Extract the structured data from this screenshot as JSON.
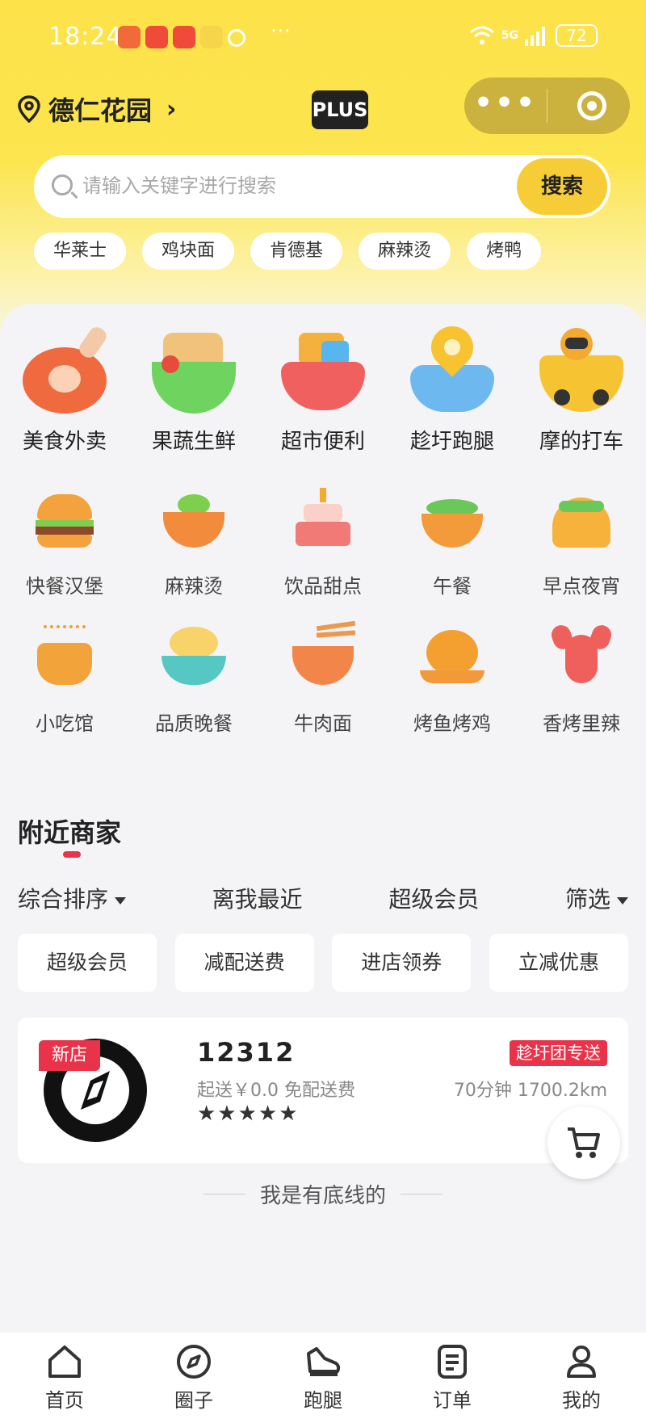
{
  "status_bar": {
    "time": "18:24",
    "signal": "5G",
    "battery": "72"
  },
  "location": {
    "name": "德仁花园"
  },
  "plus_label": "PLUS",
  "search": {
    "placeholder": "请输入关键字进行搜索",
    "button_label": "搜索"
  },
  "hot_tags": [
    "华莱士",
    "鸡块面",
    "肯德基",
    "麻辣烫",
    "烤鸭"
  ],
  "main_categories": [
    {
      "label": "美食外卖",
      "icon": "roast-leg-icon"
    },
    {
      "label": "果蔬生鲜",
      "icon": "vegetable-basket-icon"
    },
    {
      "label": "超市便利",
      "icon": "shopping-cart-icon"
    },
    {
      "label": "趁圩跑腿",
      "icon": "map-pin-icon"
    },
    {
      "label": "摩的打车",
      "icon": "motorbike-rider-icon"
    }
  ],
  "sub_categories_row1": [
    {
      "label": "快餐汉堡",
      "icon": "burger-icon"
    },
    {
      "label": "麻辣烫",
      "icon": "spicy-bowl-icon"
    },
    {
      "label": "饮品甜点",
      "icon": "cake-icon"
    },
    {
      "label": "午餐",
      "icon": "lunch-bowl-icon"
    },
    {
      "label": "早点夜宵",
      "icon": "taco-icon"
    }
  ],
  "sub_categories_row2": [
    {
      "label": "小吃馆",
      "icon": "pot-icon"
    },
    {
      "label": "品质晚餐",
      "icon": "dinner-bowl-icon"
    },
    {
      "label": "牛肉面",
      "icon": "noodle-bowl-icon"
    },
    {
      "label": "烤鱼烤鸡",
      "icon": "roast-chicken-icon"
    },
    {
      "label": "香烤里辣",
      "icon": "crayfish-icon"
    }
  ],
  "nearby": {
    "title": "附近商家",
    "sort_options": [
      {
        "label": "综合排序",
        "dropdown": true
      },
      {
        "label": "离我最近",
        "dropdown": false
      },
      {
        "label": "超级会员",
        "dropdown": false
      },
      {
        "label": "筛选",
        "dropdown": true
      }
    ],
    "filter_chips": [
      "超级会员",
      "减配送费",
      "进店领券",
      "立减优惠"
    ],
    "stores": [
      {
        "badge": "新店",
        "name": "12312",
        "min_order": "起送￥0.0",
        "delivery_fee": "免配送费",
        "rating_stars": "★★★★★",
        "delivery_tag": "趁圩团专送",
        "eta": "70分钟",
        "distance": "1700.2km"
      }
    ],
    "end_text": "我是有底线的"
  },
  "tabbar": [
    {
      "label": "首页",
      "icon": "home-icon"
    },
    {
      "label": "圈子",
      "icon": "compass-icon"
    },
    {
      "label": "跑腿",
      "icon": "shoe-icon"
    },
    {
      "label": "订单",
      "icon": "order-icon"
    },
    {
      "label": "我的",
      "icon": "profile-icon"
    }
  ],
  "colors": {
    "brand_yellow": "#fde24a",
    "accent_red": "#e8334a",
    "button_yellow": "#f7cd37"
  }
}
